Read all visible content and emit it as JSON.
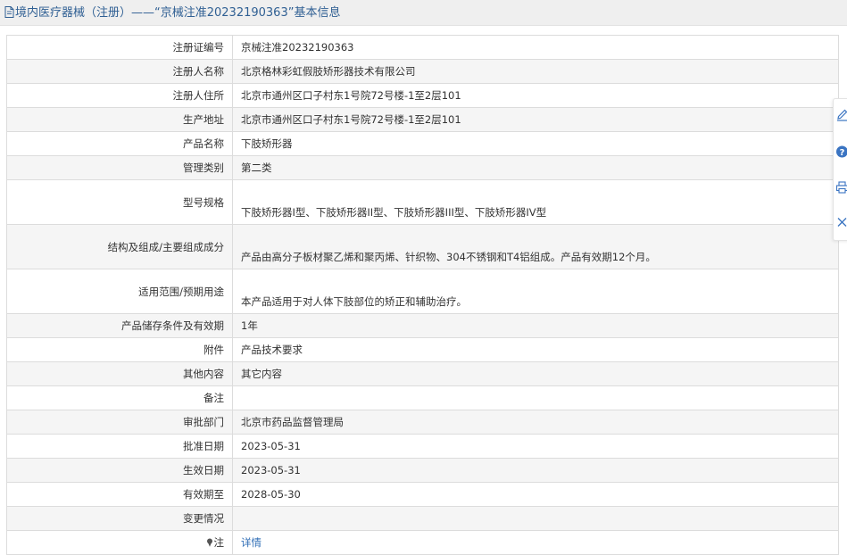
{
  "header": {
    "title": "境内医疗器械（注册）——“京械注准20232190363”基本信息"
  },
  "rows": [
    {
      "label": "注册证编号",
      "value": "京械注准20232190363"
    },
    {
      "label": "注册人名称",
      "value": "北京格林彩虹假肢矫形器技术有限公司"
    },
    {
      "label": "注册人住所",
      "value": "北京市通州区口子村东1号院72号楼-1至2层101"
    },
    {
      "label": "生产地址",
      "value": "北京市通州区口子村东1号院72号楼-1至2层101"
    },
    {
      "label": "产品名称",
      "value": "下肢矫形器"
    },
    {
      "label": "管理类别",
      "value": "第二类"
    },
    {
      "label": "型号规格",
      "value": "下肢矫形器I型、下肢矫形器II型、下肢矫形器III型、下肢矫形器IV型"
    },
    {
      "label": "结构及组成/主要组成成分",
      "value": "产品由高分子板材聚乙烯和聚丙烯、针织物、304不锈钢和T4铝组成。产品有效期12个月。"
    },
    {
      "label": "适用范围/预期用途",
      "value": "本产品适用于对人体下肢部位的矫正和辅助治疗。"
    },
    {
      "label": "产品储存条件及有效期",
      "value": "1年"
    },
    {
      "label": "附件",
      "value": "产品技术要求"
    },
    {
      "label": "其他内容",
      "value": "其它内容"
    },
    {
      "label": "备注",
      "value": ""
    },
    {
      "label": "审批部门",
      "value": "北京市药品监督管理局"
    },
    {
      "label": "批准日期",
      "value": "2023-05-31"
    },
    {
      "label": "生效日期",
      "value": "2023-05-31"
    },
    {
      "label": "有效期至",
      "value": "2028-05-30"
    },
    {
      "label": "变更情况",
      "value": ""
    }
  ],
  "note_row": {
    "label": "注",
    "link": "详情",
    "icon": "pin-icon"
  },
  "side_toolbar": [
    "edit-icon",
    "help-icon",
    "print-icon",
    "close-icon"
  ],
  "colors": {
    "accent": "#2f5f93",
    "link": "#2d6cb5",
    "header_bg": "#efefef",
    "row_shade": "#f5f5f5",
    "border": "#dcdcdc"
  }
}
